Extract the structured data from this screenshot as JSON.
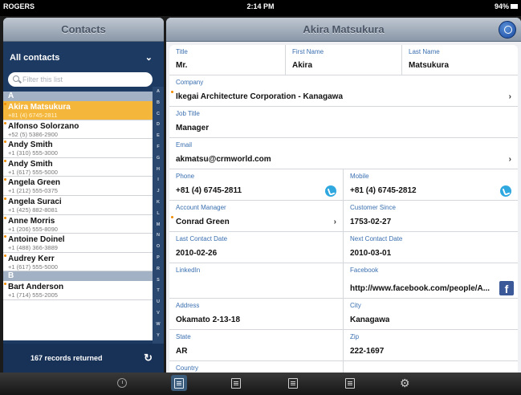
{
  "status": {
    "carrier": "ROGERS",
    "time": "2:14 PM",
    "battery": "94%"
  },
  "left": {
    "title": "Contacts",
    "selector": "All contacts",
    "filter_placeholder": "Filter this list",
    "index": [
      "A",
      "B",
      "C",
      "D",
      "E",
      "F",
      "G",
      "H",
      "I",
      "J",
      "K",
      "L",
      "M",
      "N",
      "O",
      "P",
      "R",
      "S",
      "T",
      "U",
      "V",
      "W",
      "Y",
      "Z"
    ],
    "sections": [
      {
        "letter": "A",
        "rows": [
          {
            "name": "Akira Matsukura",
            "phone": "+81 (4) 6745-2811",
            "selected": true
          },
          {
            "name": "Alfonso Solorzano",
            "phone": "+52 (5) 5386-2900"
          },
          {
            "name": "Andy Smith",
            "phone": "+1 (310) 555-3000"
          },
          {
            "name": "Andy Smith",
            "phone": "+1 (617) 555-5000"
          },
          {
            "name": "Angela Green",
            "phone": "+1 (212) 555-0375"
          },
          {
            "name": "Angela Suraci",
            "phone": "+1 (425) 882-8081"
          },
          {
            "name": "Anne Morris",
            "phone": "+1 (206) 555-8090"
          },
          {
            "name": "Antoine Doinel",
            "phone": "+1 (488) 366-3889"
          },
          {
            "name": "Audrey Kerr",
            "phone": "+1 (617) 555-5000"
          }
        ]
      },
      {
        "letter": "B",
        "rows": [
          {
            "name": "Bart Anderson",
            "phone": "+1 (714) 555-2005"
          }
        ]
      }
    ],
    "footer": "167 records returned"
  },
  "right": {
    "title": "Akira Matsukura",
    "fields": {
      "title": {
        "label": "Title",
        "value": "Mr."
      },
      "first_name": {
        "label": "First Name",
        "value": "Akira"
      },
      "last_name": {
        "label": "Last Name",
        "value": "Matsukura"
      },
      "company": {
        "label": "Company",
        "value": "Ikegai Architecture Corporation - Kanagawa"
      },
      "job_title": {
        "label": "Job Title",
        "value": "Manager"
      },
      "email": {
        "label": "Email",
        "value": "akmatsu@crmworld.com"
      },
      "phone": {
        "label": "Phone",
        "value": "+81 (4) 6745-2811"
      },
      "mobile": {
        "label": "Mobile",
        "value": "+81 (4) 6745-2812"
      },
      "account_manager": {
        "label": "Account Manager",
        "value": "Conrad Green"
      },
      "customer_since": {
        "label": "Customer Since",
        "value": "1753-02-27"
      },
      "last_contact": {
        "label": "Last Contact Date",
        "value": "2010-02-26"
      },
      "next_contact": {
        "label": "Next Contact Date",
        "value": "2010-03-01"
      },
      "linkedin": {
        "label": "LinkedIn",
        "value": ""
      },
      "facebook": {
        "label": "Facebook",
        "value": "http://www.facebook.com/people/A..."
      },
      "address": {
        "label": "Address",
        "value": "Okamato 2-13-18"
      },
      "city": {
        "label": "City",
        "value": "Kanagawa"
      },
      "state": {
        "label": "State",
        "value": "AR"
      },
      "zip": {
        "label": "Zip",
        "value": "222-1697"
      },
      "country": {
        "label": "Country",
        "value": ""
      }
    }
  },
  "tabbar": {
    "active_index": 1
  }
}
